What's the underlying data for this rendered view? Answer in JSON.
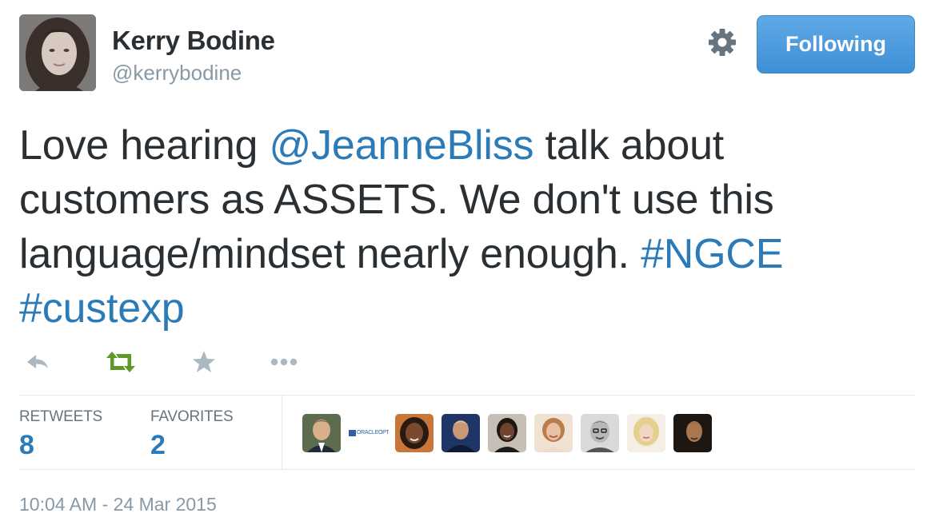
{
  "profile": {
    "name": "Kerry Bodine",
    "handle": "@kerrybodine"
  },
  "header": {
    "follow_label": "Following",
    "settings_icon": "gear-icon"
  },
  "tweet": {
    "parts": [
      {
        "type": "text",
        "value": "Love hearing "
      },
      {
        "type": "mention",
        "value": "@JeanneBliss"
      },
      {
        "type": "text",
        "value": " talk about customers as ASSETS. We don't use this language/mindset nearly enough. "
      },
      {
        "type": "hashtag",
        "value": "#NGCE"
      },
      {
        "type": "text",
        "value": " "
      },
      {
        "type": "hashtag",
        "value": "#custexp"
      }
    ]
  },
  "actions": {
    "reply_icon": "reply-icon",
    "retweet_icon": "retweet-icon",
    "favorite_icon": "star-icon",
    "more_icon": "more-icon"
  },
  "stats": {
    "retweets_label": "RETWEETS",
    "retweets_count": "8",
    "favorites_label": "FAVORITES",
    "favorites_count": "2"
  },
  "engagers": {
    "avatars": [
      "avatar-1",
      "avatar-2",
      "avatar-3",
      "avatar-4",
      "avatar-5",
      "avatar-6",
      "avatar-7",
      "avatar-8",
      "avatar-9"
    ],
    "logo_text": "ORACLEOPTION"
  },
  "timestamp": "10:04 AM - 24 Mar 2015",
  "colors": {
    "link": "#2b7bb9",
    "retweet_green": "#609928",
    "muted": "#8899a6",
    "button_blue": "#4a9ae0"
  }
}
